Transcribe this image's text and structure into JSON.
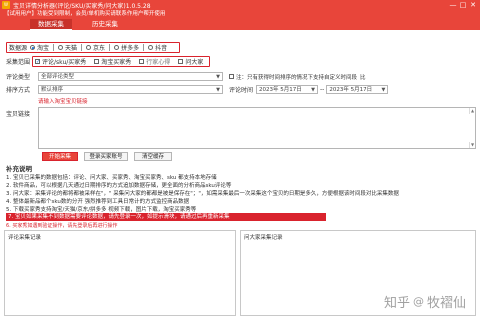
{
  "window": {
    "title": "宝贝详情分析器(评论/SKU/买家秀/问大家)1.0.5.28",
    "minimize_label": "—",
    "maximize_label": "□",
    "close_label": "✕"
  },
  "trial_notice": "【试用用户】功能受到限制，会员/单机购买请联系作用户帮开使用",
  "tabs": [
    {
      "label": "数据采集",
      "active": true
    },
    {
      "label": "历史采集",
      "active": false
    }
  ],
  "data_source": {
    "label": "数据源",
    "options": [
      {
        "label": "淘宝",
        "selected": true
      },
      {
        "label": "天猫",
        "selected": false
      },
      {
        "label": "京东",
        "selected": false
      },
      {
        "label": "拼多多",
        "selected": false
      },
      {
        "label": "抖音",
        "selected": false
      }
    ]
  },
  "collect_scope": {
    "label": "采集范围",
    "options": [
      {
        "label": "评论/sku/买家秀",
        "checked": true,
        "enabled": true
      },
      {
        "label": "淘宝买家秀",
        "checked": false,
        "enabled": true
      },
      {
        "label": "行家心得",
        "checked": false,
        "enabled": false
      },
      {
        "label": "问大家",
        "checked": false,
        "enabled": true
      }
    ]
  },
  "comment_type": {
    "label": "评论类型",
    "value": "全部评论类型",
    "hint_checkbox": "注：只有获得时间排序的情况下支持自定义时间段",
    "hint_suffix": "比"
  },
  "sort": {
    "label": "排序方式",
    "value": "默认排序",
    "time_label": "评论时间",
    "date_from": "2023年 5月17日",
    "date_to": "2023年 5月17日",
    "date_sep": "--"
  },
  "link_hint": "请输入淘宝宝贝链接",
  "link_label": "宝贝链接",
  "buttons": {
    "start": "开始采集",
    "login": "登录买家账号",
    "clear": "清空缓存"
  },
  "notes": {
    "title": "补充说明",
    "lines": [
      "1. 宝贝已采集的数据包括：评论、问大家、买家秀、淘宝买家秀、sku 都支持本地存储",
      "2. 软件商品，可以根据几天通过日期排序的方式追加数据存储，更全面的分析商品sku评论等",
      "3. 问大家：采集评论的都将都被采样在\"，\" 采集问大家的都都是被是保存在\"；\"，如需采集最后一次采集这个宝贝的日期是多久，方便根据该时间段对比采集数据",
      "4. 整体最新品都个sku数的分开 强烈推荐到工具日常计的方式监控商品数据",
      "5. 下载买家秀支持淘宝/天猫/京东/拼多多 视频下载，图片下载，淘宝买家秀等"
    ],
    "red_line": "6. 买家秀如遇到验证操作，请先登录后再进行操作",
    "banner": "7. 宝贝如果采集不到数据需要评论数据，请先登录一次，如提示滑块，请通过后再重新采集"
  },
  "panels": {
    "left_title": "评论采集记录",
    "right_title": "问大家采集记录"
  },
  "watermark": {
    "brand": "知乎",
    "at": "@",
    "author": "牧褶仙"
  }
}
